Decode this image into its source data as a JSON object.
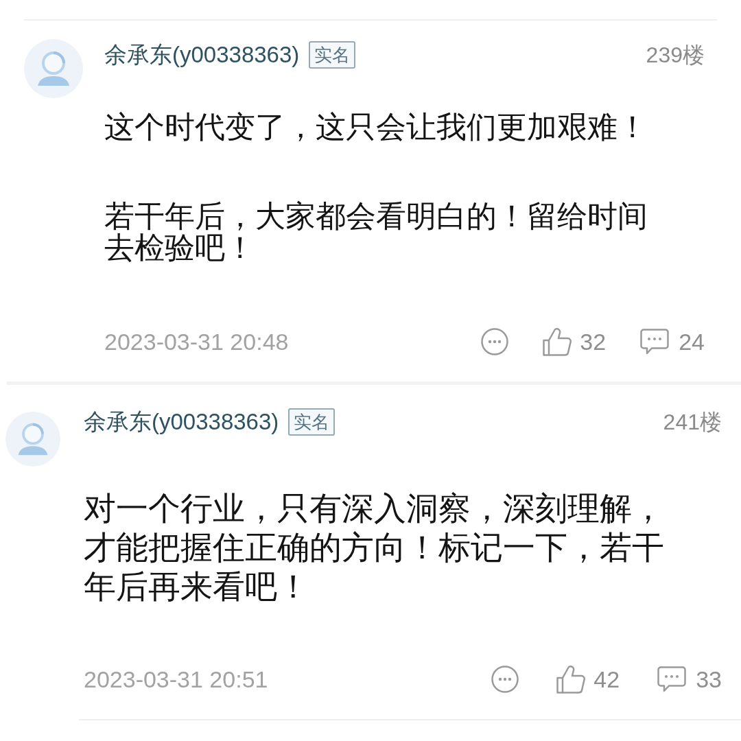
{
  "comments": [
    {
      "author": "余承东(y00338363)",
      "badge": "实名",
      "floor": "239楼",
      "paragraphs": [
        {
          "lines": [
            "这个时代变了，这只会让我们更加艰难！"
          ]
        },
        {
          "lines": [
            "若干年后，大家都会看明白的！留给时间",
            "去检验吧！"
          ]
        }
      ],
      "time": "2023-03-31 20:48",
      "likes": "32",
      "replies": "24"
    },
    {
      "author": "余承东(y00338363)",
      "badge": "实名",
      "floor": "241楼",
      "paragraphs": [
        {
          "lines": [
            "对一个行业，只有深入洞察，深刻理解，",
            "才能把握住正确的方向！标记一下，若干",
            "年后再来看吧！"
          ]
        }
      ],
      "time": "2023-03-31 20:51",
      "likes": "42",
      "replies": "33"
    }
  ]
}
